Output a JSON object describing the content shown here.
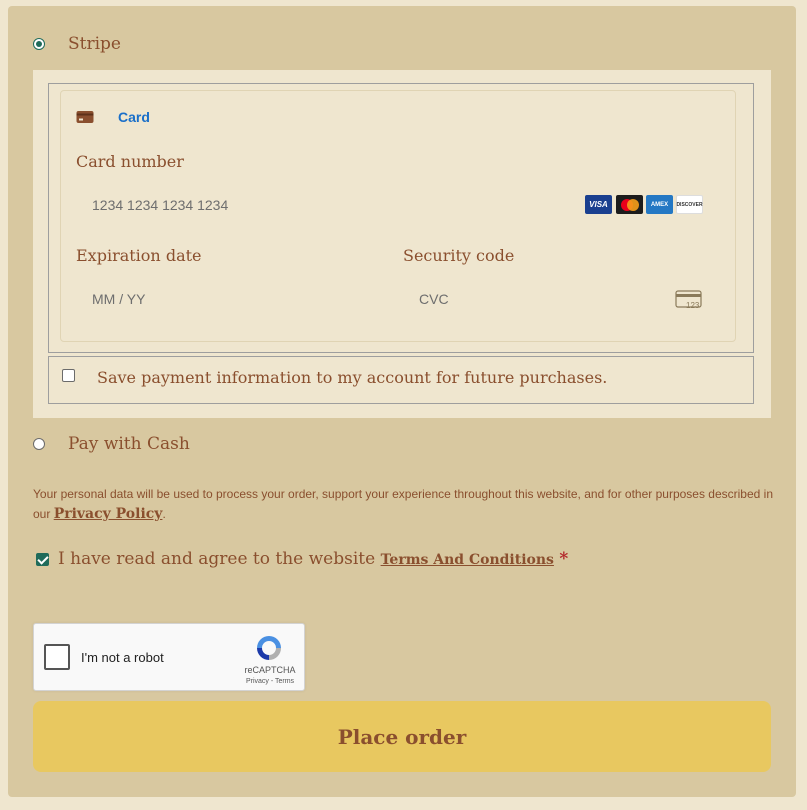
{
  "payment_methods": {
    "stripe": {
      "label": "Stripe",
      "selected": true
    },
    "cash": {
      "label": "Pay with Cash",
      "selected": false
    }
  },
  "stripe_form": {
    "tab_label": "Card",
    "card_number_label": "Card number",
    "card_number_placeholder": "1234 1234 1234 1234",
    "brands": {
      "visa": "VISA",
      "mastercard": "mastercard-icon",
      "amex": "AMEX",
      "discover": "DISCOVER"
    },
    "expiration_label": "Expiration date",
    "expiration_placeholder": "MM / YY",
    "security_label": "Security code",
    "security_placeholder": "CVC",
    "cvc_icon_text": "123"
  },
  "save_payment": {
    "label": "Save payment information to my account for future purchases.",
    "checked": false
  },
  "privacy": {
    "text": "Your personal data will be used to process your order, support your experience throughout this website, and for other purposes described in our",
    "link": "Privacy Policy",
    "suffix": "."
  },
  "terms": {
    "text": "I have read and agree to the website",
    "link": "Terms And Conditions",
    "required_mark": "*",
    "checked": true
  },
  "recaptcha": {
    "label": "I'm not a robot",
    "brand": "reCAPTCHA",
    "links": "Privacy - Terms"
  },
  "place_order_label": "Place order",
  "colors": {
    "panel_bg": "#d8c8a0",
    "text_brown": "#8a4f2e",
    "button_yellow": "#e8c860",
    "tab_blue": "#1a6fc9",
    "checkbox_green": "#1f6b5a"
  }
}
